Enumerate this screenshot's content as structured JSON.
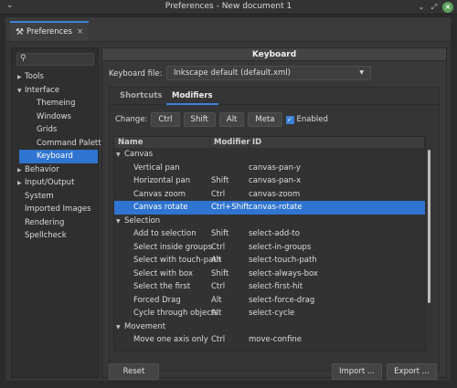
{
  "window": {
    "title": "Preferences - New document 1"
  },
  "doc_tab": {
    "label": "Preferences",
    "close": "×"
  },
  "sidebar": {
    "items": [
      {
        "label": "Tools",
        "level": 0,
        "arrow": "▶"
      },
      {
        "label": "Interface",
        "level": 0,
        "arrow": "▼"
      },
      {
        "label": "Themeing",
        "level": 1
      },
      {
        "label": "Windows",
        "level": 1
      },
      {
        "label": "Grids",
        "level": 1
      },
      {
        "label": "Command Palette",
        "level": 1
      },
      {
        "label": "Keyboard",
        "level": 1,
        "selected": true
      },
      {
        "label": "Behavior",
        "level": 0,
        "arrow": "▶"
      },
      {
        "label": "Input/Output",
        "level": 0,
        "arrow": "▶"
      },
      {
        "label": "System",
        "level": 0
      },
      {
        "label": "Imported Images",
        "level": 0
      },
      {
        "label": "Rendering",
        "level": 0
      },
      {
        "label": "Spellcheck",
        "level": 0
      }
    ]
  },
  "panel": {
    "title": "Keyboard",
    "keyboard_file_label": "Keyboard file:",
    "keyboard_file_value": "Inkscape default (default.xml)",
    "tabs": [
      "Shortcuts",
      "Modifiers"
    ],
    "change_label": "Change:",
    "modifier_buttons": [
      "Ctrl",
      "Shift",
      "Alt",
      "Meta"
    ],
    "enabled_label": "Enabled",
    "columns": [
      "Name",
      "Modifier",
      "ID"
    ],
    "rows": [
      {
        "group": true,
        "name": "Canvas"
      },
      {
        "name": "Vertical pan",
        "mod": "",
        "id": "canvas-pan-y"
      },
      {
        "name": "Horizontal pan",
        "mod": "Shift",
        "id": "canvas-pan-x"
      },
      {
        "name": "Canvas zoom",
        "mod": "Ctrl",
        "id": "canvas-zoom"
      },
      {
        "name": "Canvas rotate",
        "mod": "Ctrl+Shift",
        "id": "canvas-rotate",
        "selected": true
      },
      {
        "group": true,
        "name": "Selection"
      },
      {
        "name": "Add to selection",
        "mod": "Shift",
        "id": "select-add-to"
      },
      {
        "name": "Select inside groups",
        "mod": "Ctrl",
        "id": "select-in-groups"
      },
      {
        "name": "Select with touch-path",
        "mod": "Alt",
        "id": "select-touch-path"
      },
      {
        "name": "Select with box",
        "mod": "Shift",
        "id": "select-always-box"
      },
      {
        "name": "Select the first",
        "mod": "Ctrl",
        "id": "select-first-hit"
      },
      {
        "name": "Forced Drag",
        "mod": "Alt",
        "id": "select-force-drag"
      },
      {
        "name": "Cycle through objects",
        "mod": "Alt",
        "id": "select-cycle"
      },
      {
        "group": true,
        "name": "Movement"
      },
      {
        "name": "Move one axis only",
        "mod": "Ctrl",
        "id": "move-confine"
      }
    ],
    "reset_label": "Reset",
    "import_label": "Import ...",
    "export_label": "Export ..."
  },
  "colors": {
    "accent": "#2f74d0",
    "panel": "#383838"
  }
}
